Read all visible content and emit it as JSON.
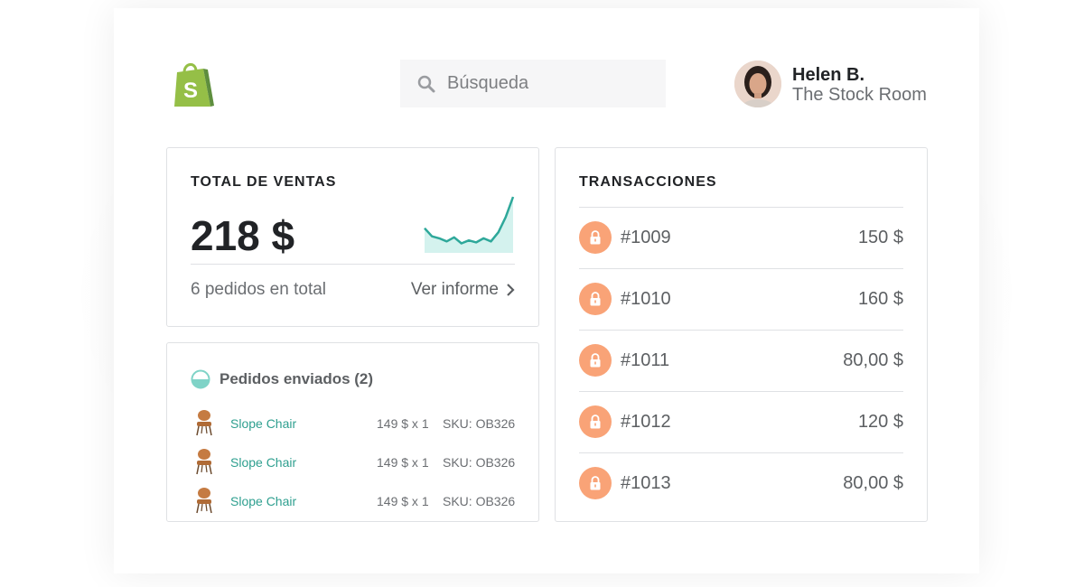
{
  "header": {
    "logo_icon": "shopify-bag-icon",
    "logo_letter": "S",
    "search": {
      "placeholder": "Búsqueda",
      "icon": "search-icon"
    },
    "user": {
      "name": "Helen B.",
      "store": "The Stock Room"
    }
  },
  "sales": {
    "title": "TOTAL DE VENTAS",
    "amount": "218 $",
    "orders_text": "6 pedidos en total",
    "report_link": "Ver informe",
    "sparkline": [
      0.38,
      0.22,
      0.18,
      0.12,
      0.2,
      0.08,
      0.14,
      0.1,
      0.18,
      0.12,
      0.3,
      0.6,
      1.0
    ],
    "accent_color": "#2ea89a"
  },
  "shipped": {
    "title": "Pedidos enviados (2)",
    "items": [
      {
        "name": "Slope Chair",
        "price_qty": "149 $ x 1",
        "sku": "SKU: OB326"
      },
      {
        "name": "Slope Chair",
        "price_qty": "149 $ x 1",
        "sku": "SKU: OB326"
      },
      {
        "name": "Slope Chair",
        "price_qty": "149 $ x 1",
        "sku": "SKU: OB326"
      }
    ]
  },
  "transactions": {
    "title": "TRANSACCIONES",
    "rows": [
      {
        "id": "#1009",
        "amount": "150 $"
      },
      {
        "id": "#1010",
        "amount": "160 $"
      },
      {
        "id": "#1011",
        "amount": "80,00 $"
      },
      {
        "id": "#1012",
        "amount": "120 $"
      },
      {
        "id": "#1013",
        "amount": "80,00 $"
      }
    ],
    "badge_color": "#f9a377"
  }
}
